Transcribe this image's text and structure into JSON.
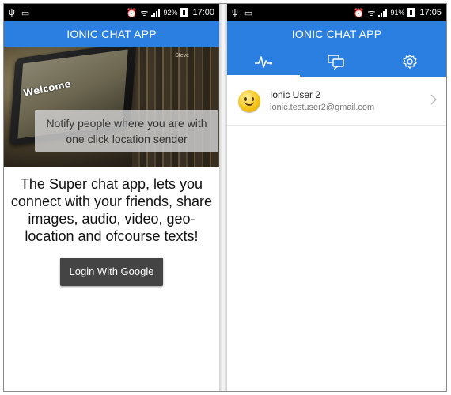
{
  "left_screen": {
    "status_bar": {
      "time": "17:00",
      "battery_percent": "92%"
    },
    "header": {
      "title": "IONIC CHAT APP"
    },
    "hero": {
      "overlay_text": "Notify people where you are with one click location sender",
      "tablet_text": "Welcome",
      "book_text": "Steve"
    },
    "description": "The Super chat app, lets you connect with your friends, share images, audio, video, geo-location and ofcourse texts!",
    "login_button": "Login With Google"
  },
  "right_screen": {
    "status_bar": {
      "time": "17:05",
      "battery_percent": "91%"
    },
    "header": {
      "title": "IONIC CHAT APP"
    },
    "tabs": [
      {
        "icon": "pulse-icon",
        "active": true
      },
      {
        "icon": "chat-icon",
        "active": false
      },
      {
        "icon": "gear-icon",
        "active": false
      }
    ],
    "users": [
      {
        "name": "Ionic User 2",
        "email": "ionic.testuser2@gmail.com",
        "avatar": "smiley-icon"
      }
    ]
  },
  "colors": {
    "primary": "#2a7fe0",
    "button": "#444444",
    "status_bar": "#000000"
  }
}
